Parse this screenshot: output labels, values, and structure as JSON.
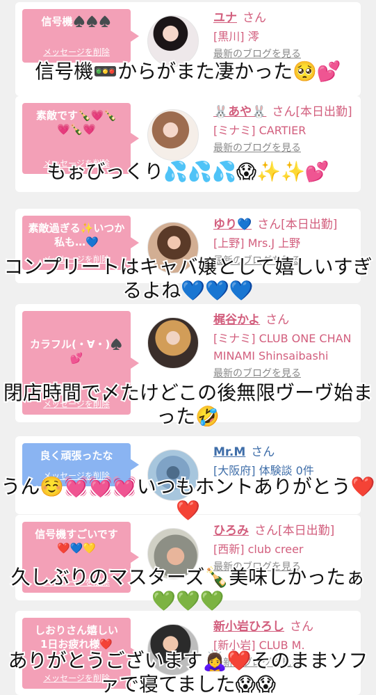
{
  "cards": [
    {
      "bubble": "信号機♠️♠️♠️",
      "delete_label": "メッセージを削除",
      "name": "ユナ",
      "suffix": "さん",
      "shop": "[黒川] 澪",
      "blog": "最新のブログを見る"
    },
    {
      "bubble": "素敵です🍾💗🍾\n💗🍾💗",
      "delete_label": "メッセージを削除",
      "name": "🐰あや🐰",
      "suffix": "さん[本日出勤]",
      "shop": "[ミナミ] CARTIER",
      "blog": "最新のブログを見る"
    },
    {
      "bubble": "素敵過ぎる✨いつか私も…💙",
      "delete_label": "メッセージを削除",
      "name": "ゆり💙",
      "suffix": "さん[本日出勤]",
      "shop": "[上野] Mrs.J 上野",
      "blog": "最新のブログを見る"
    },
    {
      "bubble": "カラフル(・∀・)♠️💕",
      "delete_label": "メッセージを削除",
      "name": "梶谷かよ",
      "suffix": "さん",
      "shop": "[ミナミ] CLUB ONE CHAN MINAMI Shinsaibashi",
      "blog": "最新のブログを見る"
    },
    {
      "bubble": "良く頑張ったな",
      "delete_label": "メッセージを削除",
      "name": "Mr.M",
      "suffix": "さん",
      "shop": "[大阪府] 体験談 0件",
      "blog": ""
    },
    {
      "bubble": "信号機すごいです\n❤️💙💛",
      "delete_label": "メッセージを削除",
      "name": "ひろみ",
      "suffix": "さん[本日出勤]",
      "shop": "[西新] club creer",
      "blog": "最新のブログを見る"
    },
    {
      "bubble": "しおりさん嬉しい\n1日お疲れ様❤️",
      "delete_label": "メッセージを削除",
      "name": "新小岩ひろし",
      "suffix": "さん",
      "shop": "[新小岩] CLUB M.",
      "blog": "最新のブログを見る"
    }
  ],
  "captions": [
    "信号機🚥からがまた凄かった🥺💕",
    "もぉびっくり💦💦💦😱✨✨💕",
    "コンプリートはキャバ嬢として嬉しいすぎるよね💙💙💙",
    "閉店時間で〆たけどこの後無限ヴーヴ始まった🤣",
    "うん☺️💓💓💓いつもホントありがとう❤️❤️",
    "久しぶりのマスターズ🍾美味しかったぁ💚💚💚",
    "ありがとうございます🙇‍♀️❤️そのままソファで寝てました😱😱"
  ],
  "colors": {
    "pink_bubble": "#f3a0b7",
    "blue_bubble": "#8ab4f2",
    "name_pink": "#d25e7d",
    "name_blue": "#3f6ea9"
  }
}
